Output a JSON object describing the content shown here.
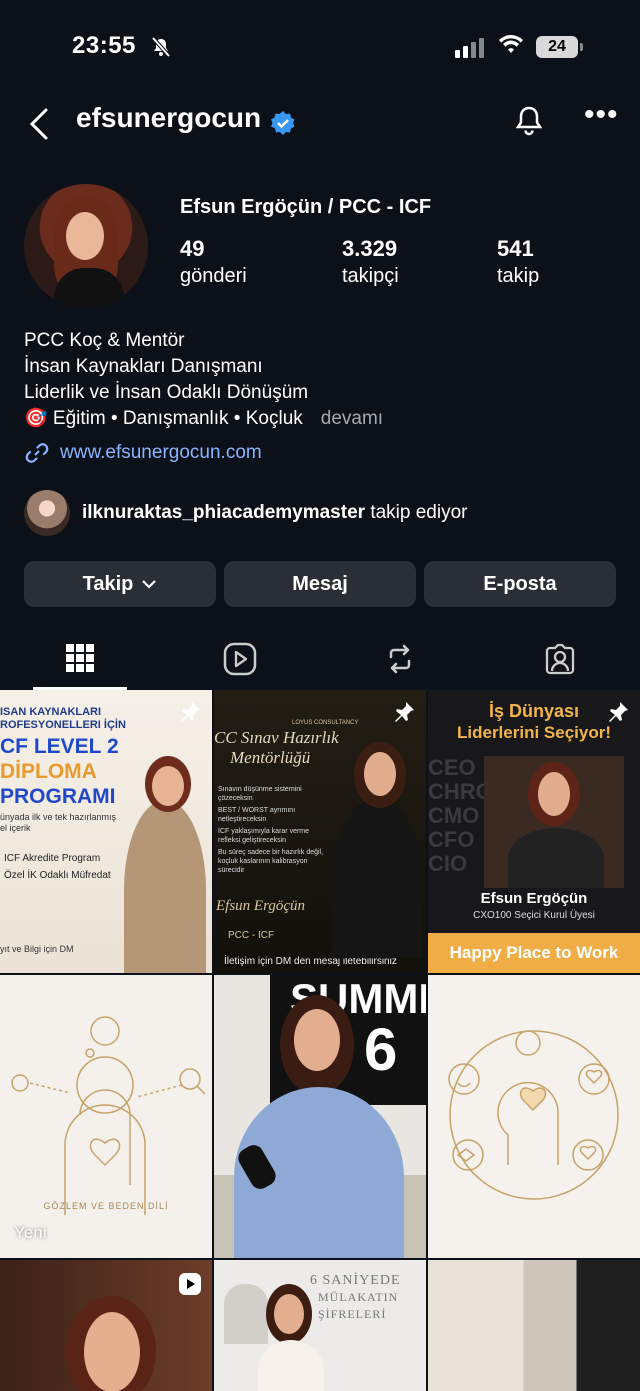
{
  "status_bar": {
    "time": "23:55",
    "battery": "24"
  },
  "header": {
    "username": "efsunergocun"
  },
  "profile": {
    "full_name": "Efsun Ergöçün / PCC - ICF",
    "stats": [
      {
        "value": "49",
        "label": "gönderi"
      },
      {
        "value": "3.329",
        "label": "takipçi"
      },
      {
        "value": "541",
        "label": "takip"
      }
    ],
    "bio_lines": [
      "PCC Koç & Mentör",
      "İnsan Kaynakları Danışmanı",
      "Liderlik ve İnsan Odaklı Dönüşüm"
    ],
    "bio_last": "🎯 Eğitim • Danışmanlık • Koçluk",
    "more": "devamı",
    "link": "www.efsunergocun.com"
  },
  "followed_by": {
    "user": "ilknuraktas_phiacademymaster",
    "suffix": " takip ediyor"
  },
  "buttons": {
    "follow": "Takip",
    "message": "Mesaj",
    "email": "E-posta"
  },
  "tabs": [
    {
      "icon": "grid-icon",
      "active": true
    },
    {
      "icon": "reels-icon",
      "active": false
    },
    {
      "icon": "repost-icon",
      "active": false
    },
    {
      "icon": "tagged-icon",
      "active": false
    }
  ],
  "posts": {
    "p1": {
      "line1": "ISAN KAYNAKLARI",
      "line2": "ROFESYONELLERI İÇİN",
      "t1": "CF LEVEL 2",
      "t2": "DİPLOMA",
      "t3": "PROGRAMI",
      "sub1": "ünyada ilk ve tek hazırlanmış",
      "sub2": "el içerik",
      "item1": "ICF Akredite Program",
      "item2": "Özel İK Odaklı Müfredat",
      "footer": "yıt ve Bilgi için DM"
    },
    "p2": {
      "brand": "LOYUS CONSULTANCY",
      "t1": "CC Sınav Hazırlık",
      "t2": "Mentörlüğü",
      "b1": "Sınavın düşünme sistemini çözeceksin",
      "b2": "BEST / WORST ayrımını netleştireceksin",
      "b3": "ICF yaklaşımıyla karar verme refleksi geliştireceksin",
      "b4": "Bu süreç sadece bir hazırlık değil, koçluk kaslarının kalibrasyon sürecidir",
      "sign": "Efsun Ergöçün",
      "pcc": "PCC - ICF",
      "footer": "İletişim için DM den mesaj iletebilirsiniz"
    },
    "p3": {
      "t1": "İş Dünyası",
      "t2": "Liderlerini Seçiyor!",
      "roles": "CEO CHRO CMO CFO CIO",
      "name": "Efsun Ergöçün",
      "sub": "CXO100 Seçici Kurul Üyesi",
      "footer": "Happy Place to Work"
    },
    "p4": {
      "caption": "GÖZLEM VE BEDEN DİLİ",
      "badge": "Yeni"
    },
    "p5": {
      "banner": "SUMMIT",
      "num": "6"
    },
    "p7": {},
    "p8": {
      "t1": "6 SANİYEDE",
      "t2": "MÜLAKATIN",
      "t3": "ŞİFRELERİ"
    }
  }
}
